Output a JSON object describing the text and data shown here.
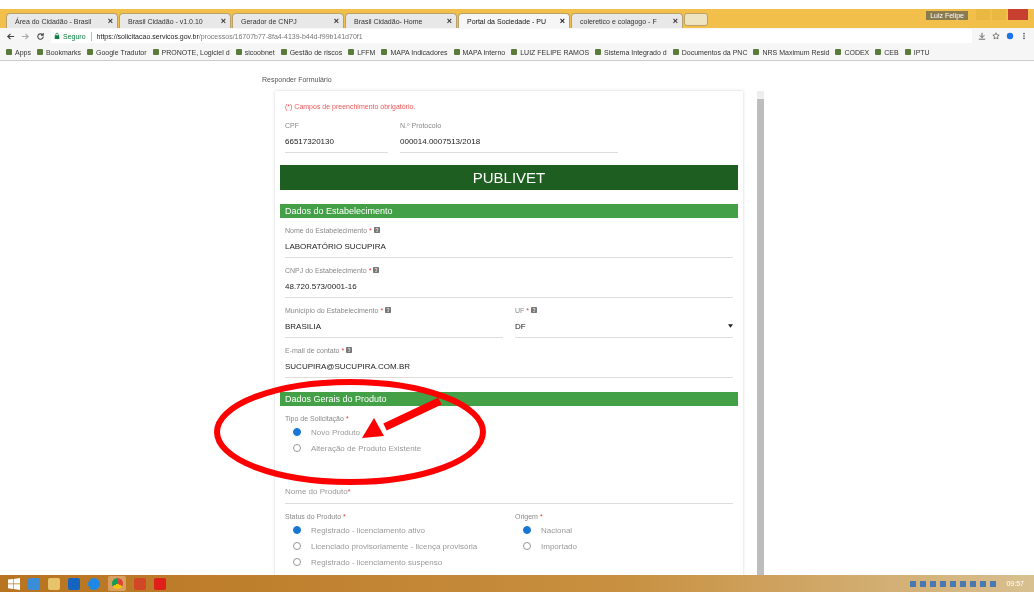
{
  "browser": {
    "tabs": [
      {
        "title": "Área do Cidadão - Brasil",
        "selected": false
      },
      {
        "title": "Brasil Cidadão - v1.0.10",
        "selected": false
      },
      {
        "title": "Gerador de CNPJ",
        "selected": false
      },
      {
        "title": "Brasil Cidadão- Home",
        "selected": false
      },
      {
        "title": "Portal da Sociedade - PU",
        "selected": true
      },
      {
        "title": "coleretico e colagogo - F",
        "selected": false
      }
    ],
    "close_glyph": "×",
    "user": "Luiz Felipe",
    "secure_label": "Seguro",
    "url_host": "https://solicitacao.servicos.gov.br",
    "url_path": "/processos/16707b77-8fa4-4139-b44d-f99b141d70f1",
    "bookmarks": [
      "Apps",
      "Bookmarks",
      "Google Tradutor",
      "PRONOTE, Logiciel d",
      "sicoobnet",
      "Gestão de riscos",
      "LFFM",
      "MAPA Indicadores",
      "MAPA Interno",
      "LUIZ FELIPE RAMOS",
      "Sistema Integrado d",
      "Documentos da PNC",
      "NRS Maximum Resid",
      "CODEX",
      "CEB",
      "IPTU"
    ]
  },
  "page": {
    "breadcrumb": "Responder Formulário",
    "required_note": "(*) Campos de preenchimento obrigatório.",
    "top_fields": [
      {
        "label": "CPF",
        "value": "66517320130"
      },
      {
        "label": "N.º Protocolo",
        "value": "000014.0007513/2018"
      }
    ],
    "banner": "PUBLIVET",
    "sections": [
      {
        "title": "Dados do Estabelecimento",
        "rows": [
          [
            {
              "kind": "text",
              "label": "Nome do Estabelecimento",
              "mark": "*",
              "help": true,
              "value": "LABORATÓRIO SUCUPIRA"
            }
          ],
          [
            {
              "kind": "text",
              "label": "CNPJ do Estabelecimento",
              "mark": "*",
              "help": true,
              "value": "48.720.573/0001-16"
            }
          ],
          [
            {
              "kind": "text",
              "label": "Município do Estabelecimento",
              "mark": "*",
              "help": true,
              "value": "BRASILIA"
            },
            {
              "kind": "select",
              "label": "UF",
              "mark": "*",
              "help": true,
              "value": "DF"
            }
          ],
          [
            {
              "kind": "text",
              "label": "E-mail de contato",
              "mark": "*",
              "help": true,
              "value": "SUCUPIRA@SUCUPIRA.COM.BR"
            }
          ]
        ]
      },
      {
        "title": "Dados Gerais do Produto",
        "rows": [
          [
            {
              "kind": "radio",
              "label": "Tipo de Solicitação",
              "mark": "*",
              "options": [
                {
                  "label": "Novo Produto",
                  "selected": true
                },
                {
                  "label": "Alteração de Produto Existente",
                  "selected": false
                }
              ]
            }
          ],
          [
            {
              "kind": "empty",
              "label": "Nome do Produto",
              "mark": "*"
            }
          ],
          [
            {
              "kind": "radio",
              "label": "Status do Produto",
              "mark": "*",
              "options": [
                {
                  "label": "Registrado - licenciamento ativo",
                  "selected": true
                },
                {
                  "label": "Licenciado provisoriamente - licença provisória",
                  "selected": false
                },
                {
                  "label": "Registrado - licenciamento suspenso",
                  "selected": false
                }
              ]
            },
            {
              "kind": "radio",
              "label": "Origem",
              "mark": "*",
              "options": [
                {
                  "label": "Nacional",
                  "selected": true
                },
                {
                  "label": "Importado",
                  "selected": false
                }
              ]
            }
          ]
        ]
      }
    ]
  },
  "taskbar": {
    "clock": "09:57"
  }
}
